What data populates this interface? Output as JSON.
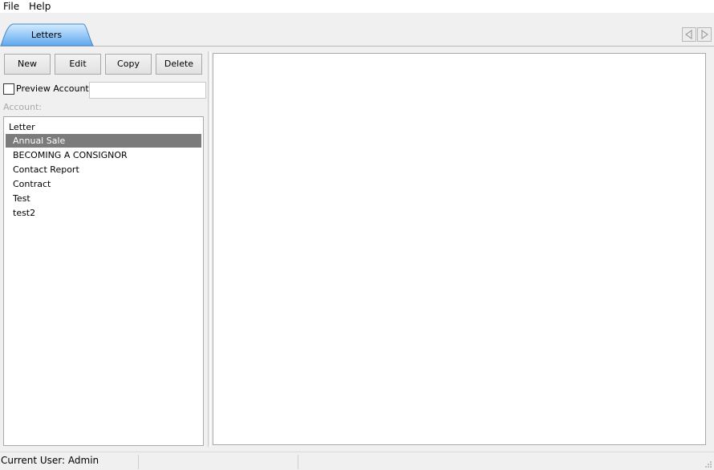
{
  "menubar": {
    "items": [
      {
        "label": "File"
      },
      {
        "label": "Help"
      }
    ]
  },
  "tabs": [
    {
      "label": "Letters",
      "active": true
    }
  ],
  "toolbar": {
    "new_label": "New",
    "edit_label": "Edit",
    "copy_label": "Copy",
    "delete_label": "Delete"
  },
  "preview": {
    "checkbox_label": "Preview Account",
    "checked": false,
    "account_value": "",
    "account_label": "Account:"
  },
  "letters_list": {
    "header": "Letter",
    "items": [
      {
        "label": "Annual Sale",
        "selected": true
      },
      {
        "label": "BECOMING A CONSIGNOR",
        "selected": false
      },
      {
        "label": "Contact Report",
        "selected": false
      },
      {
        "label": "Contract",
        "selected": false
      },
      {
        "label": "Test",
        "selected": false
      },
      {
        "label": "test2",
        "selected": false
      }
    ]
  },
  "statusbar": {
    "current_user": "Current User: Admin"
  },
  "colors": {
    "tab_active_top": "#d4ecff",
    "tab_active_bottom": "#5fa8ef",
    "selection": "#7b7b7b",
    "window_bg": "#f0f0f0"
  },
  "icons": [
    "tab-scroll-left-icon",
    "tab-scroll-right-icon",
    "resize-grip-icon"
  ]
}
